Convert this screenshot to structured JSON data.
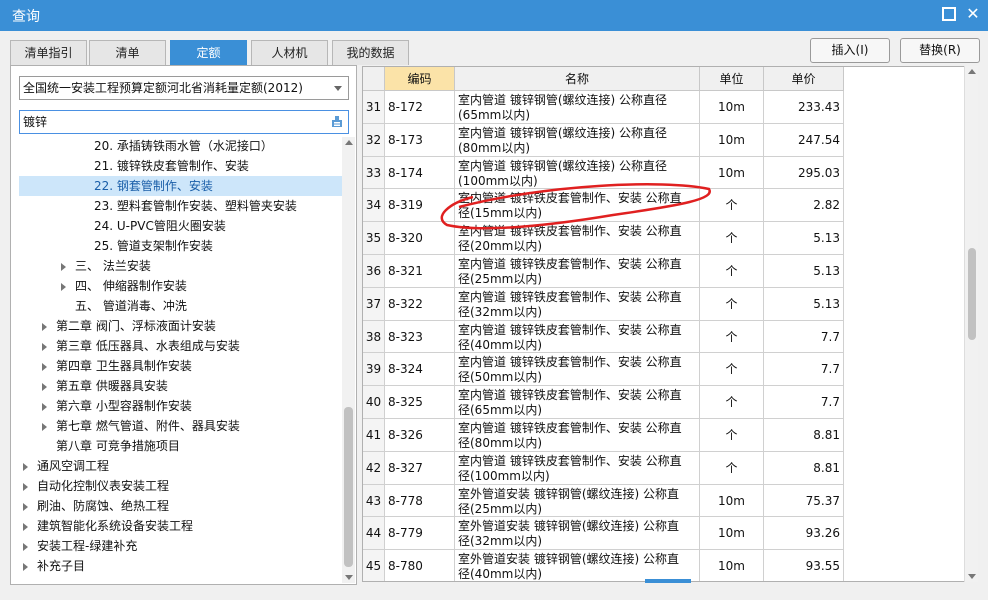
{
  "window": {
    "title": "查询"
  },
  "tabs": [
    "清单指引",
    "清单",
    "定额",
    "人材机",
    "我的数据"
  ],
  "actions": {
    "insert": "插入(I)",
    "replace": "替换(R)"
  },
  "left": {
    "combo_value": "全国统一安装工程预算定额河北省消耗量定额(2012)",
    "search_value": "镀锌",
    "tree": [
      {
        "label": "20. 承插铸铁雨水管（水泥接口）",
        "level": 4,
        "expandable": false
      },
      {
        "label": "21. 镀锌铁皮套管制作、安装",
        "level": 4,
        "expandable": false
      },
      {
        "label": "22. 钢套管制作、安装",
        "level": 4,
        "expandable": false,
        "selected": true
      },
      {
        "label": "23. 塑料套管制作安装、塑料管夹安装",
        "level": 4,
        "expandable": false
      },
      {
        "label": "24. U-PVC管阻火圈安装",
        "level": 4,
        "expandable": false
      },
      {
        "label": "25. 管道支架制作安装",
        "level": 4,
        "expandable": false
      },
      {
        "label": "三、 法兰安装",
        "level": 3,
        "expandable": true
      },
      {
        "label": "四、 伸缩器制作安装",
        "level": 3,
        "expandable": true
      },
      {
        "label": "五、 管道消毒、冲洗",
        "level": 3,
        "expandable": false
      },
      {
        "label": "第二章 阀门、浮标液面计安装",
        "level": 2,
        "expandable": true
      },
      {
        "label": "第三章 低压器具、水表组成与安装",
        "level": 2,
        "expandable": true
      },
      {
        "label": "第四章 卫生器具制作安装",
        "level": 2,
        "expandable": true
      },
      {
        "label": "第五章 供暖器具安装",
        "level": 2,
        "expandable": true
      },
      {
        "label": "第六章 小型容器制作安装",
        "level": 2,
        "expandable": true
      },
      {
        "label": "第七章 燃气管道、附件、器具安装",
        "level": 2,
        "expandable": true
      },
      {
        "label": "第八章 可竞争措施项目",
        "level": 2,
        "expandable": false
      },
      {
        "label": "通风空调工程",
        "level": 1,
        "expandable": true
      },
      {
        "label": "自动化控制仪表安装工程",
        "level": 1,
        "expandable": true
      },
      {
        "label": "刷油、防腐蚀、绝热工程",
        "level": 1,
        "expandable": true
      },
      {
        "label": "建筑智能化系统设备安装工程",
        "level": 1,
        "expandable": true
      },
      {
        "label": "安装工程-绿建补充",
        "level": 1,
        "expandable": true
      },
      {
        "label": "补充子目",
        "level": 1,
        "expandable": true
      }
    ]
  },
  "grid": {
    "headers": {
      "code": "编码",
      "name": "名称",
      "unit": "单位",
      "price": "单价"
    },
    "rows": [
      {
        "num": "31",
        "code": "8-172",
        "name1": "室内管道 镀锌钢管(螺纹连接) 公称直径",
        "name2": "(65mm以内)",
        "unit": "10m",
        "price": "233.43"
      },
      {
        "num": "32",
        "code": "8-173",
        "name1": "室内管道 镀锌钢管(螺纹连接) 公称直径",
        "name2": "(80mm以内)",
        "unit": "10m",
        "price": "247.54"
      },
      {
        "num": "33",
        "code": "8-174",
        "name1": "室内管道 镀锌钢管(螺纹连接) 公称直径",
        "name2": "(100mm以内)",
        "unit": "10m",
        "price": "295.03"
      },
      {
        "num": "34",
        "code": "8-319",
        "name1": "室内管道 镀锌铁皮套管制作、安装 公称直",
        "name2": "径(15mm以内)",
        "unit": "个",
        "price": "2.82"
      },
      {
        "num": "35",
        "code": "8-320",
        "name1": "室内管道 镀锌铁皮套管制作、安装 公称直",
        "name2": "径(20mm以内)",
        "unit": "个",
        "price": "5.13"
      },
      {
        "num": "36",
        "code": "8-321",
        "name1": "室内管道 镀锌铁皮套管制作、安装 公称直",
        "name2": "径(25mm以内)",
        "unit": "个",
        "price": "5.13"
      },
      {
        "num": "37",
        "code": "8-322",
        "name1": "室内管道 镀锌铁皮套管制作、安装 公称直",
        "name2": "径(32mm以内)",
        "unit": "个",
        "price": "5.13"
      },
      {
        "num": "38",
        "code": "8-323",
        "name1": "室内管道 镀锌铁皮套管制作、安装 公称直",
        "name2": "径(40mm以内)",
        "unit": "个",
        "price": "7.7"
      },
      {
        "num": "39",
        "code": "8-324",
        "name1": "室内管道 镀锌铁皮套管制作、安装 公称直",
        "name2": "径(50mm以内)",
        "unit": "个",
        "price": "7.7"
      },
      {
        "num": "40",
        "code": "8-325",
        "name1": "室内管道 镀锌铁皮套管制作、安装 公称直",
        "name2": "径(65mm以内)",
        "unit": "个",
        "price": "7.7"
      },
      {
        "num": "41",
        "code": "8-326",
        "name1": "室内管道 镀锌铁皮套管制作、安装 公称直",
        "name2": "径(80mm以内)",
        "unit": "个",
        "price": "8.81"
      },
      {
        "num": "42",
        "code": "8-327",
        "name1": "室内管道 镀锌铁皮套管制作、安装 公称直",
        "name2": "径(100mm以内)",
        "unit": "个",
        "price": "8.81"
      },
      {
        "num": "43",
        "code": "8-778",
        "name1": "室外管道安装 镀锌钢管(螺纹连接) 公称直",
        "name2": "径(25mm以内)",
        "unit": "10m",
        "price": "75.37"
      },
      {
        "num": "44",
        "code": "8-779",
        "name1": "室外管道安装 镀锌钢管(螺纹连接) 公称直",
        "name2": "径(32mm以内)",
        "unit": "10m",
        "price": "93.26"
      },
      {
        "num": "45",
        "code": "8-780",
        "name1": "室外管道安装 镀锌钢管(螺纹连接) 公称直",
        "name2": "径(40mm以内)",
        "unit": "10m",
        "price": "93.55"
      }
    ],
    "highlight_row": "34",
    "highlight_color": "#e02020"
  },
  "colors": {
    "accent": "#3a8fd6",
    "selected_row": "#cde6fa",
    "code_header": "#fbe3a8"
  },
  "icons": {
    "maximize": "maximize-icon",
    "close": "close-icon",
    "search_action": "filter-search-icon",
    "dropdown": "chevron-down-icon",
    "tree_expand": "tree-expand-arrow-icon"
  }
}
